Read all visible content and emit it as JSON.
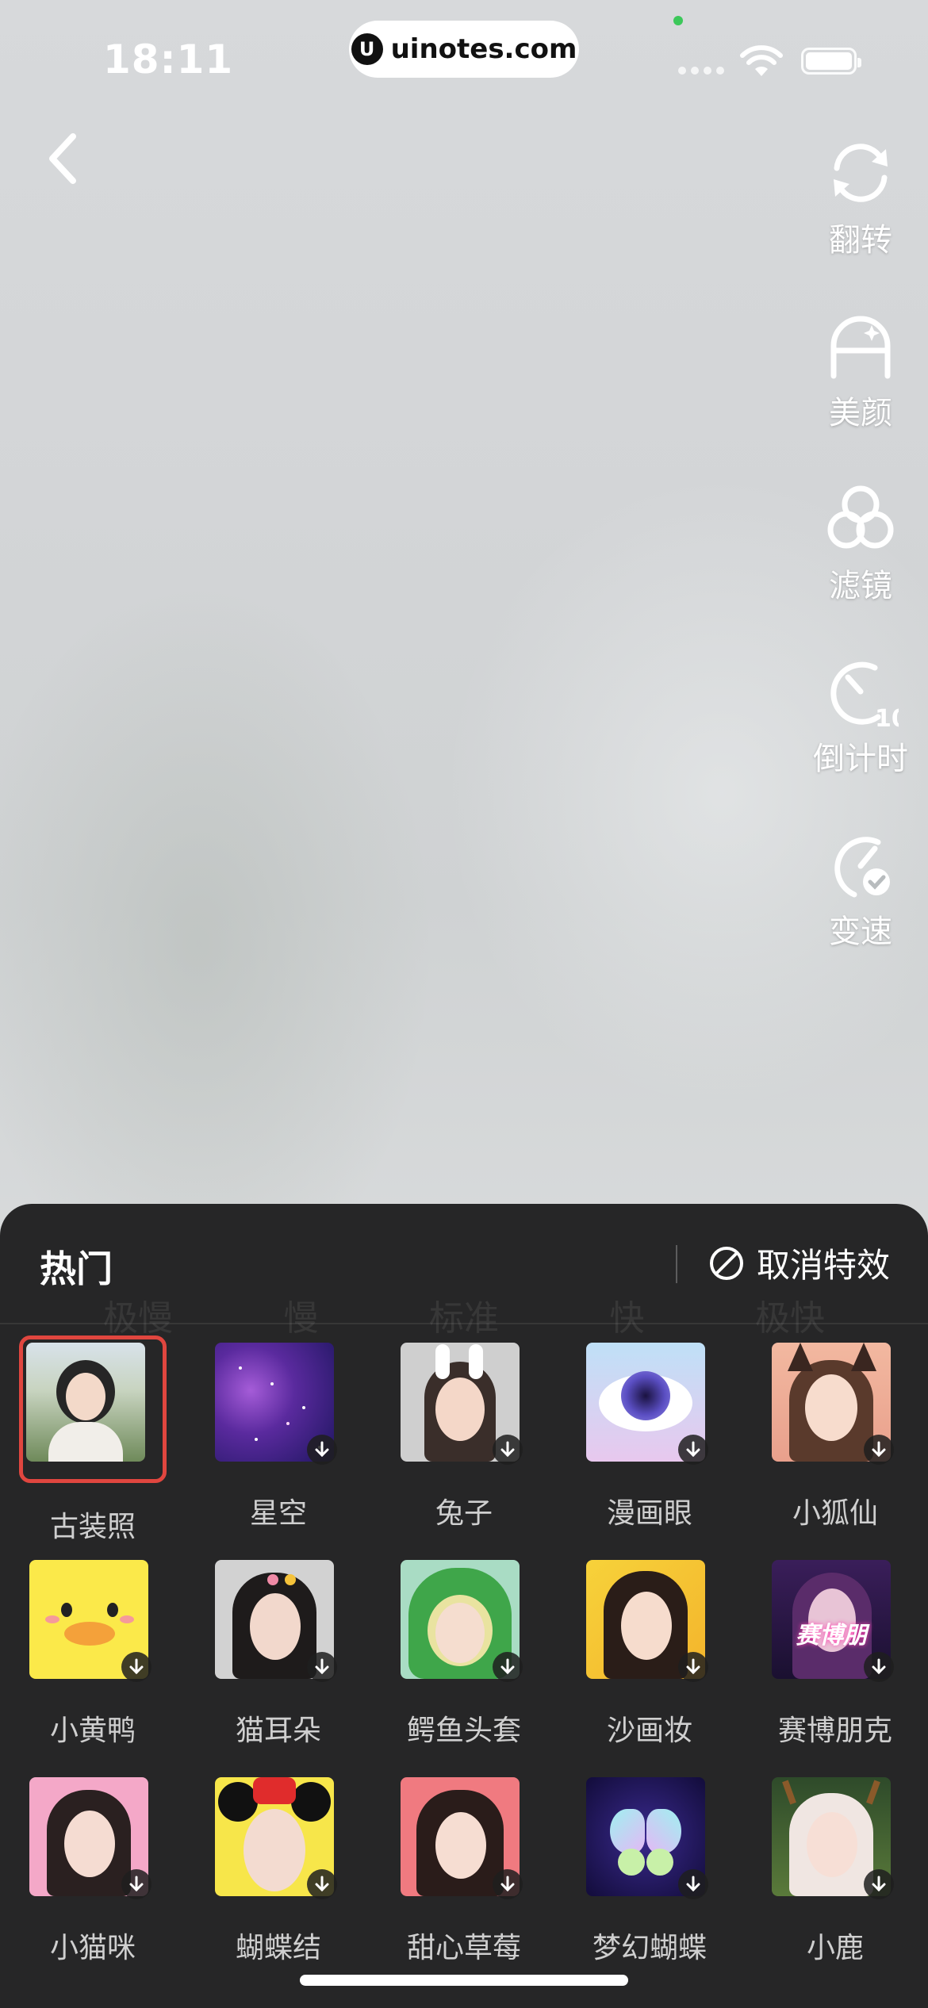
{
  "status_bar": {
    "time": "18:11",
    "url": "uinotes.com",
    "url_logo": "U",
    "icons": [
      "signal-icon",
      "wifi-icon",
      "battery-icon"
    ]
  },
  "toolbar": {
    "items": [
      {
        "label": "翻转",
        "icon": "flip-camera-icon"
      },
      {
        "label": "美颜",
        "icon": "beauty-icon"
      },
      {
        "label": "滤镜",
        "icon": "filter-icon"
      },
      {
        "label": "倒计时",
        "icon": "countdown-icon",
        "badge": "10"
      },
      {
        "label": "变速",
        "icon": "speed-icon"
      }
    ]
  },
  "panel": {
    "tab": "热门",
    "cancel_label": "取消特效",
    "ghost_speed": [
      "极慢",
      "慢",
      "标准",
      "快",
      "极快"
    ],
    "effects": [
      {
        "label": "古装照",
        "selected": true,
        "download": false
      },
      {
        "label": "星空",
        "selected": false,
        "download": true
      },
      {
        "label": "兔子",
        "selected": false,
        "download": true
      },
      {
        "label": "漫画眼",
        "selected": false,
        "download": true
      },
      {
        "label": "小狐仙",
        "selected": false,
        "download": true
      },
      {
        "label": "小黄鸭",
        "selected": false,
        "download": true
      },
      {
        "label": "猫耳朵",
        "selected": false,
        "download": true
      },
      {
        "label": "鳄鱼头套",
        "selected": false,
        "download": true
      },
      {
        "label": "沙画妆",
        "selected": false,
        "download": true
      },
      {
        "label": "赛博朋克",
        "selected": false,
        "download": true,
        "thumb_text": "赛博朋"
      },
      {
        "label": "小猫咪",
        "selected": false,
        "download": true
      },
      {
        "label": "蝴蝶结",
        "selected": false,
        "download": true
      },
      {
        "label": "甜心草莓",
        "selected": false,
        "download": true
      },
      {
        "label": "梦幻蝴蝶",
        "selected": false,
        "download": true
      },
      {
        "label": "小鹿",
        "selected": false,
        "download": true
      }
    ]
  },
  "colors": {
    "panel_bg": "#1e1e1f",
    "selected_border": "#e0463f",
    "text_primary": "#ffffff"
  }
}
